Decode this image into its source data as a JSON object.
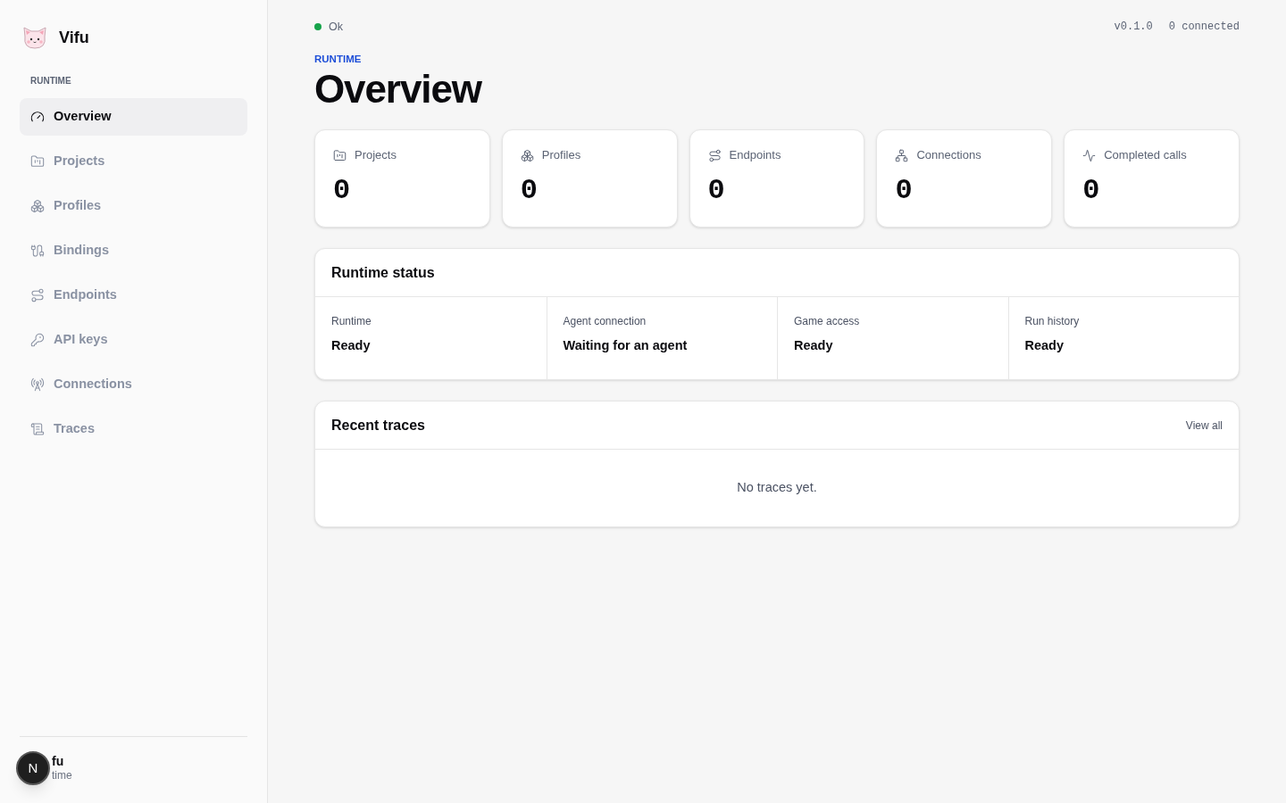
{
  "app": {
    "name": "Vifu"
  },
  "sidebar": {
    "section": "RUNTIME",
    "items": [
      {
        "label": "Overview",
        "selected": true
      },
      {
        "label": "Projects",
        "selected": false
      },
      {
        "label": "Profiles",
        "selected": false
      },
      {
        "label": "Bindings",
        "selected": false
      },
      {
        "label": "Endpoints",
        "selected": false
      },
      {
        "label": "API keys",
        "selected": false
      },
      {
        "label": "Connections",
        "selected": false
      },
      {
        "label": "Traces",
        "selected": false
      }
    ],
    "footer": {
      "title": "fu",
      "subtitle": "time",
      "badge": "N"
    }
  },
  "topbar": {
    "status": "Ok",
    "version": "v0.1.0",
    "connected": "0 connected"
  },
  "header": {
    "eyebrow": "RUNTIME",
    "title": "Overview"
  },
  "stats": [
    {
      "label": "Projects",
      "value": "0"
    },
    {
      "label": "Profiles",
      "value": "0"
    },
    {
      "label": "Endpoints",
      "value": "0"
    },
    {
      "label": "Connections",
      "value": "0"
    },
    {
      "label": "Completed calls",
      "value": "0"
    }
  ],
  "runtime_status": {
    "title": "Runtime status",
    "items": [
      {
        "label": "Runtime",
        "value": "Ready"
      },
      {
        "label": "Agent connection",
        "value": "Waiting for an agent"
      },
      {
        "label": "Game access",
        "value": "Ready"
      },
      {
        "label": "Run history",
        "value": "Ready"
      }
    ]
  },
  "recent_traces": {
    "title": "Recent traces",
    "link": "View all",
    "empty": "No traces yet."
  }
}
